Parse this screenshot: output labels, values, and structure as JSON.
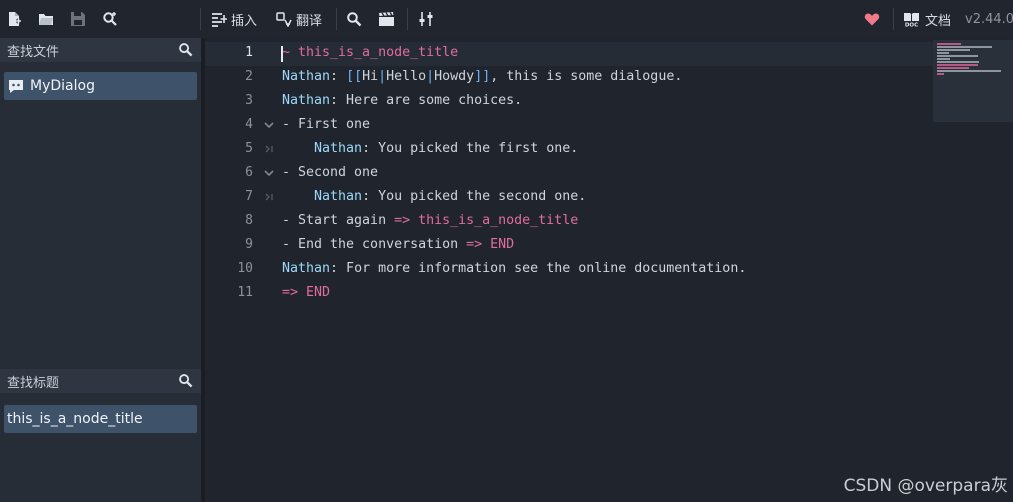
{
  "toolbar": {
    "insert_label": "插入",
    "translate_label": "翻译",
    "docs_label": "文档",
    "version": "v2.44.0",
    "icons": [
      "new-file-icon",
      "open-folder-icon",
      "save-icon",
      "search-replace-icon",
      "insert-icon",
      "translate-icon",
      "search-icon",
      "clapperboard-icon",
      "sliders-icon",
      "heart-icon",
      "doc-icon"
    ]
  },
  "sidebar": {
    "files_header": "查找文件",
    "files": [
      {
        "label": "MyDialog"
      }
    ],
    "titles_header": "查找标题",
    "titles": [
      {
        "label": "this_is_a_node_title"
      }
    ]
  },
  "editor": {
    "current_line": 1,
    "lines": [
      {
        "number": "1",
        "text": "~ this_is_a_node_title"
      },
      {
        "number": "2",
        "text": "Nathan: [[Hi|Hello|Howdy]], this is some dialogue."
      },
      {
        "number": "3",
        "text": "Nathan: Here are some choices."
      },
      {
        "number": "4",
        "text": "- First one",
        "fold": "open"
      },
      {
        "number": "5",
        "text": "    Nathan: You picked the first one.",
        "fold": "end"
      },
      {
        "number": "6",
        "text": "- Second one",
        "fold": "open"
      },
      {
        "number": "7",
        "text": "    Nathan: You picked the second one.",
        "fold": "end"
      },
      {
        "number": "8",
        "text": "- Start again => this_is_a_node_title"
      },
      {
        "number": "9",
        "text": "- End the conversation => END"
      },
      {
        "number": "10",
        "text": "Nathan: For more information see the online documentation."
      },
      {
        "number": "11",
        "text": "=> END"
      }
    ]
  },
  "colors": {
    "character": "#9cd7f9",
    "jump": "#e06ca0",
    "bracket": "#6fb2f2",
    "text": "#cdd4dc",
    "heart": "#f07a8a",
    "selection": "#3e5269"
  },
  "watermark": "CSDN @overpara灰"
}
